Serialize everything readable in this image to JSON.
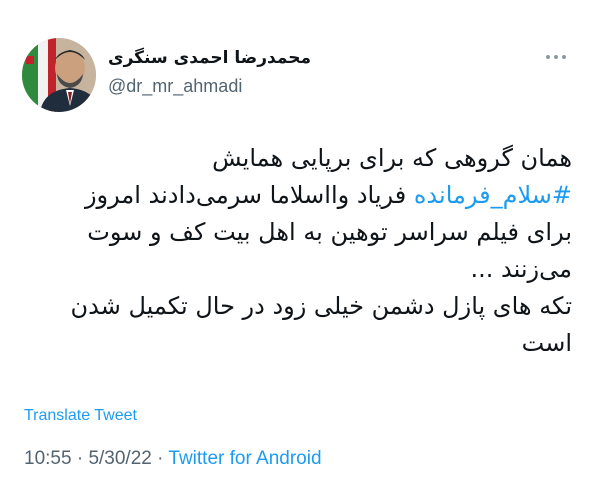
{
  "author": {
    "display_name": "محمدرضا احمدی سنگری",
    "handle": "@dr_mr_ahmadi"
  },
  "tweet": {
    "line1": "همان گروهی که برای برپایی همایش",
    "hashtag": "#سلام_فرمانده",
    "line2_rest": " فریاد وااسلاما سرمی‌دادند امروز",
    "line3": "برای فیلم سراسر توهین به اهل بیت کف و سوت",
    "line4": "می‌زنند ...",
    "line5": "تکه های پازل دشمن خیلی زود در حال تکمیل شدن",
    "line6": "است"
  },
  "translate_label": "Translate Tweet",
  "meta": {
    "time": "10:55",
    "separator": " · ",
    "date": "5/30/22",
    "source": "Twitter for Android"
  },
  "colors": {
    "link": "#1d9bf0",
    "secondary_text": "#536471",
    "primary_text": "#0f1419"
  },
  "icons": {
    "more": "more-horizontal-icon",
    "avatar": "profile-photo"
  }
}
